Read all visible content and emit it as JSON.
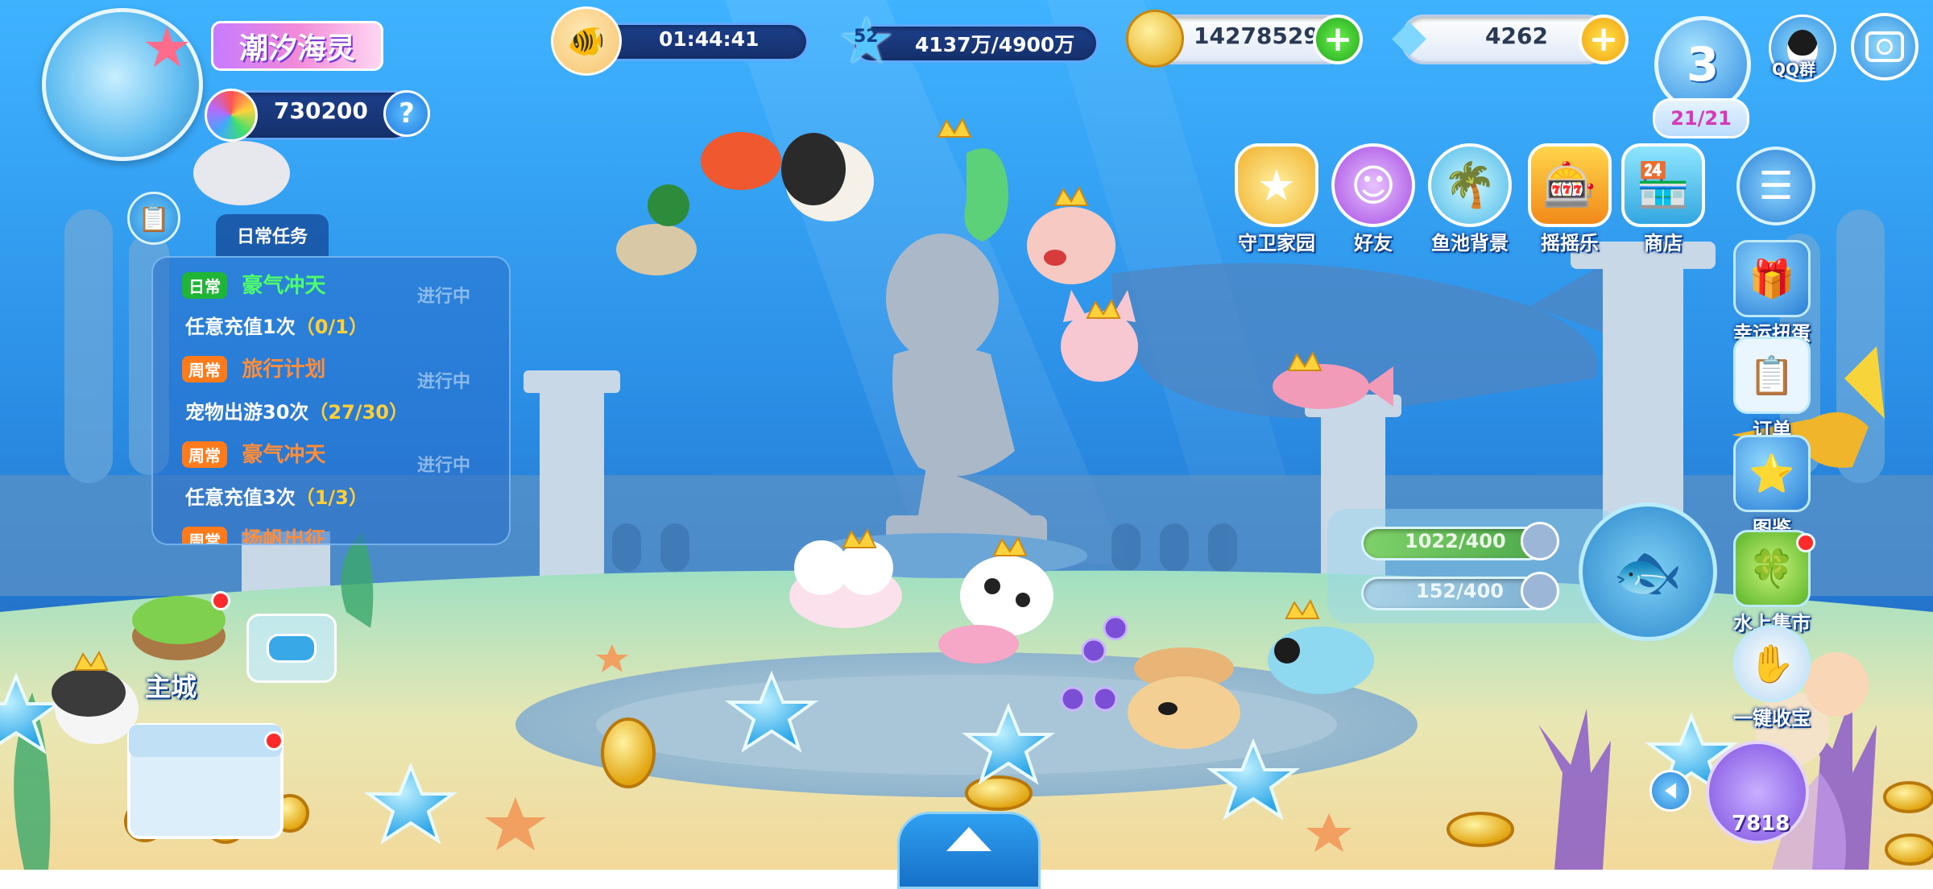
{
  "player": {
    "title": "潮汐海灵",
    "currency": "730200"
  },
  "top": {
    "timer": "01:44:41",
    "level": "52",
    "exp": "4137万/4900万",
    "coins": "14278529",
    "gems": "4262",
    "vip_level": "3",
    "vip_progress": "21/21",
    "qq_label": "QQ群"
  },
  "menu": [
    {
      "label": "守卫家园",
      "icon": "shield-icon"
    },
    {
      "label": "好友",
      "icon": "friends-icon"
    },
    {
      "label": "鱼池背景",
      "icon": "fishbowl-icon"
    },
    {
      "label": "摇摇乐",
      "icon": "slot-machine-icon"
    },
    {
      "label": "商店",
      "icon": "shop-icon"
    }
  ],
  "side": [
    {
      "label": "幸运扭蛋"
    },
    {
      "label": "订单"
    },
    {
      "label": "图鉴"
    },
    {
      "label": "水上集市"
    },
    {
      "label": "一键收宝"
    }
  ],
  "tasks": {
    "tab": "日常任务",
    "items": [
      {
        "tag": "日常",
        "name": "豪气冲天",
        "desc": "任意充值1次",
        "progress": "（0/1）",
        "status": "进行中"
      },
      {
        "tag": "周常",
        "name": "旅行计划",
        "desc": "宠物出游30次",
        "progress": "（27/30）",
        "status": "进行中"
      },
      {
        "tag": "周常",
        "name": "豪气冲天",
        "desc": "任意充值3次",
        "progress": "（1/3）",
        "status": "进行中"
      },
      {
        "tag": "周常",
        "name": "扬帆出征"
      }
    ]
  },
  "resources": {
    "bar1": "1022/400",
    "bar2": "152/400"
  },
  "bottom": {
    "city_label": "主城",
    "bag_count": "7818"
  }
}
